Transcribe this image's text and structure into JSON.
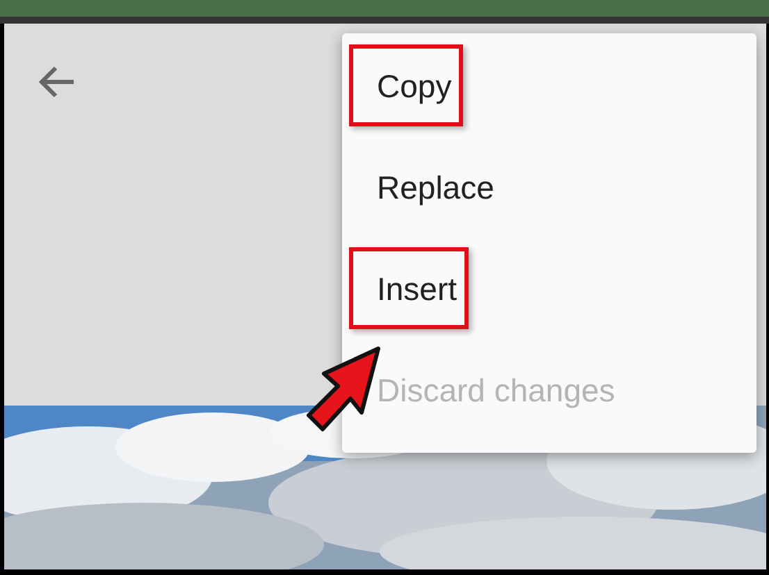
{
  "menu": {
    "items": [
      {
        "label": "Copy",
        "disabled": false,
        "highlighted": true
      },
      {
        "label": "Replace",
        "disabled": false,
        "highlighted": false
      },
      {
        "label": "Insert",
        "disabled": false,
        "highlighted": true
      },
      {
        "label": "Discard changes",
        "disabled": true,
        "highlighted": false
      }
    ]
  }
}
